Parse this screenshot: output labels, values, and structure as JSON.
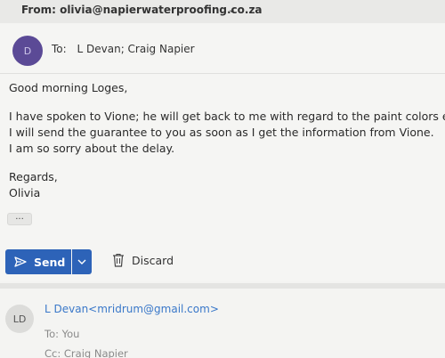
{
  "header": {
    "from_label": "From: olivia@napierwaterproofing.co.za",
    "chevron": "⌄"
  },
  "compose": {
    "avatar_initial": "D",
    "to_label": "To:",
    "recipients": "L Devan;  Craig Napier",
    "greeting": "Good morning Loges,",
    "line1": "I have spoken to Vione; he will get back to me with regard to the paint colors etc.",
    "line2": "I will send the guarantee to you as soon as I get the information from Vione.",
    "line3": "I am so sorry about the delay.",
    "signoff": "Regards,",
    "name": "Olivia",
    "ellipsis": "..."
  },
  "actions": {
    "send_label": "Send",
    "discard_label": "Discard"
  },
  "previous_message": {
    "avatar_initials": "LD",
    "from": "L Devan<mridrum@gmail.com>",
    "to": "To: You",
    "cc": "Cc: Craig Napier"
  },
  "colors": {
    "send_button": "#2d63b8",
    "avatar_d": "#5b4a96",
    "link": "#3a78c9"
  }
}
